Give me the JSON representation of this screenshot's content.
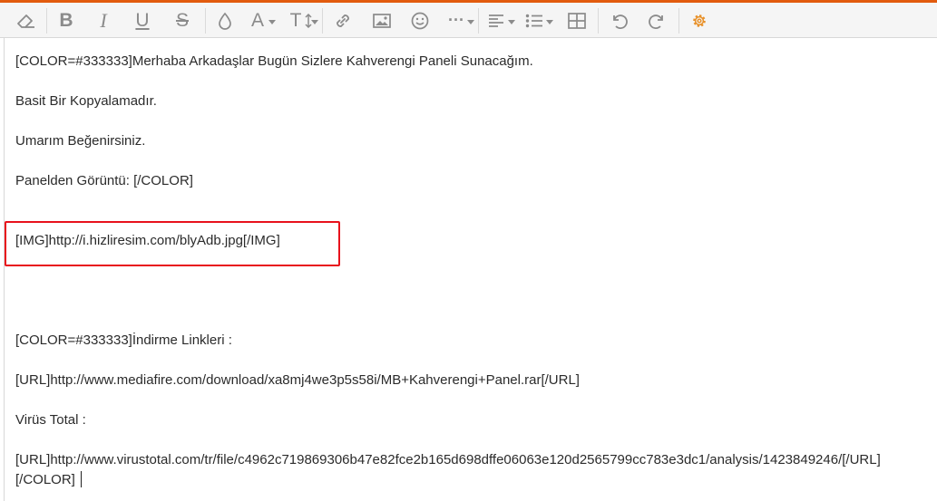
{
  "toolbar": {
    "buttons": [
      {
        "name": "clear-formatting-icon"
      },
      {
        "name": "bold-button",
        "glyph": "B"
      },
      {
        "name": "italic-button",
        "glyph": "I"
      },
      {
        "name": "underline-button",
        "glyph": "U"
      },
      {
        "name": "strikethrough-button",
        "glyph": "S"
      },
      {
        "name": "text-color-icon"
      },
      {
        "name": "font-family-button",
        "glyph": "A"
      },
      {
        "name": "font-size-button",
        "glyph": "T"
      },
      {
        "name": "link-icon"
      },
      {
        "name": "image-icon"
      },
      {
        "name": "smiley-icon"
      },
      {
        "name": "more-options-button",
        "glyph": "···"
      },
      {
        "name": "align-button"
      },
      {
        "name": "list-button"
      },
      {
        "name": "table-icon"
      },
      {
        "name": "undo-icon"
      },
      {
        "name": "redo-icon"
      },
      {
        "name": "settings-gear-icon"
      }
    ],
    "accent_color": "#e25b0e",
    "settings_color": "#e8912a"
  },
  "editor": {
    "lines": [
      "[COLOR=#333333]Merhaba Arkadaşlar Bugün Sizlere Kahverengi Paneli Sunacağım.",
      "Basit Bir Kopyalamadır.",
      "Umarım Beğenirsiniz.",
      "Panelden Görüntü: [/COLOR]",
      "[IMG]http://i.hizliresim.com/blyAdb.jpg[/IMG]",
      "[COLOR=#333333]İndirme Linkleri :",
      "[URL]http://www.mediafire.com/download/xa8mj4we3p5s58i/MB+Kahverengi+Panel.rar[/URL]",
      "Virüs Total :",
      "[URL]http://www.virustotal.com/tr/file/c4962c719869306b47e82fce2b165d698dffe06063e120d2565799cc783e3dc1/analysis/1423849246/[/URL]",
      "[/COLOR]"
    ],
    "highlight_color": "#e8121c"
  }
}
